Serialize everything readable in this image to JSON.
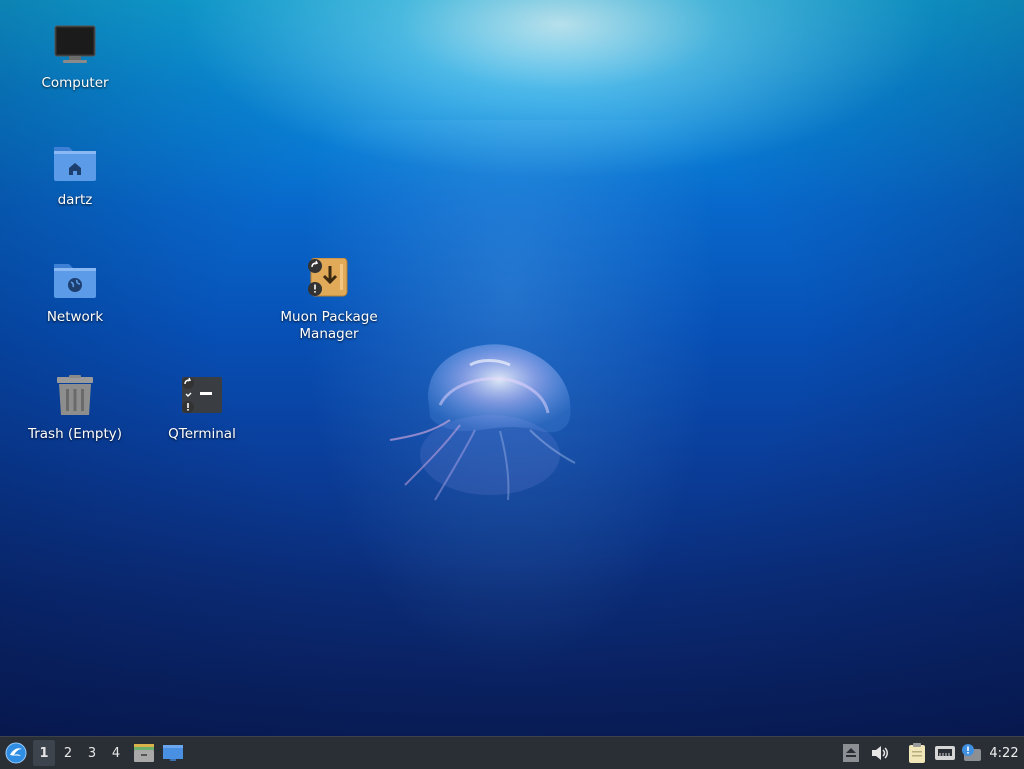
{
  "desktop": {
    "icons": [
      {
        "id": "computer",
        "label": "Computer",
        "icon": "monitor-icon"
      },
      {
        "id": "home",
        "label": "dartz",
        "icon": "home-folder-icon"
      },
      {
        "id": "network",
        "label": "Network",
        "icon": "network-folder-icon"
      },
      {
        "id": "trash",
        "label": "Trash (Empty)",
        "icon": "trash-icon"
      },
      {
        "id": "qterminal",
        "label": "QTerminal",
        "icon": "terminal-icon"
      },
      {
        "id": "muon",
        "label": "Muon Package Manager",
        "icon": "package-manager-icon"
      }
    ]
  },
  "taskbar": {
    "menu_icon": "lubuntu-menu-icon",
    "workspaces": [
      "1",
      "2",
      "3",
      "4"
    ],
    "active_workspace": "1",
    "quicklaunch": [
      "file-manager-icon",
      "show-desktop-icon"
    ],
    "tray": [
      "eject-icon",
      "volume-icon",
      "clipboard-icon",
      "network-icon",
      "update-notifier-icon"
    ],
    "clock": "4:22"
  },
  "colors": {
    "taskbar_bg": "#2a2f36",
    "folder_blue": "#5b9be8",
    "accent": "#2f8de4"
  }
}
